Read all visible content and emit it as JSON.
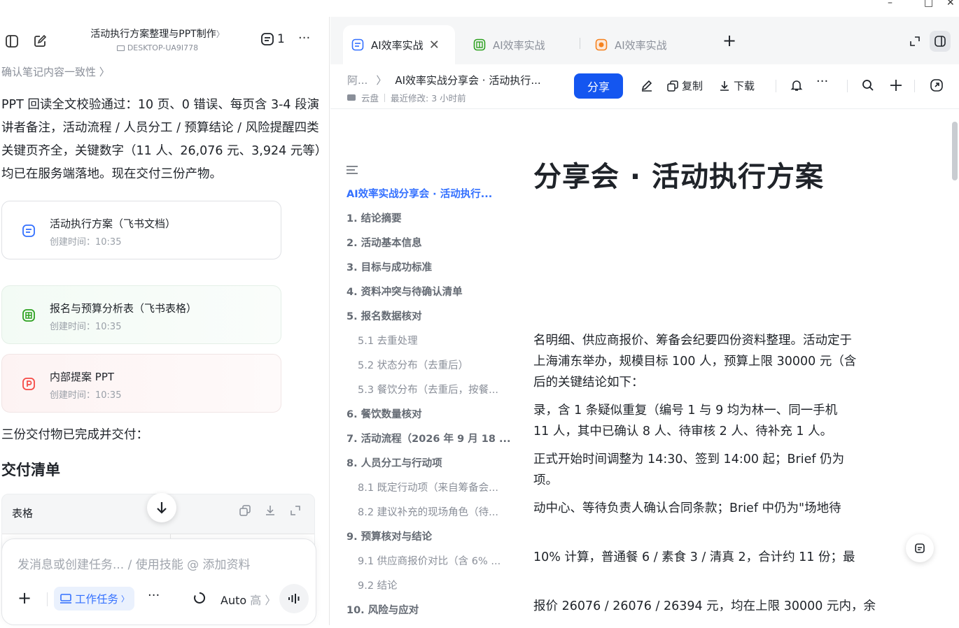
{
  "window": {
    "minimize": "–",
    "maximize": "□",
    "close": "✕"
  },
  "left": {
    "title": "活动执行方案整理与PPT制作",
    "title_chevron": "〉",
    "device": "DESKTOP-UA9I778",
    "message_count": "1",
    "more": "···",
    "confirm_link": "确认笔记内容一致性 〉",
    "summary": "PPT 回读全文校验通过：10 页、0 错误、每页含 3-4 段演讲者备注，活动流程 / 人员分工 / 预算结论 / 风险提醒四类关键页齐全，关键数字（11 人、26,076 元、3,924 元等）均已在服务端落地。现在交付三份产物。",
    "cards": [
      {
        "title": "活动执行方案（飞书文档）",
        "time": "创建时间：10:35",
        "icon": "doc-icon",
        "color": "#3370ff"
      },
      {
        "title": "报名与预算分析表（飞书表格）",
        "time": "创建时间：10:35",
        "icon": "sheet-icon",
        "color": "#2ea121"
      },
      {
        "title": "内部提案 PPT",
        "time": "创建时间：10:35",
        "icon": "ppt-icon",
        "color": "#f54a45"
      }
    ],
    "done_text": "三份交付物已完成并交付：",
    "deliver_title": "交付清单",
    "table_label": "表格",
    "composer": {
      "placeholder": "发消息或创建任务... / 使用技能 @ 添加资料",
      "plus": "+",
      "task_label": "工作任务",
      "task_chevron": "〉",
      "more": "···",
      "model": "Auto",
      "model_level": "高 〉"
    }
  },
  "right": {
    "tabs": [
      {
        "label": "AI效率实战",
        "icon": "doc-icon",
        "color": "#3370ff"
      },
      {
        "label": "AI效率实战",
        "icon": "sheet-icon",
        "color": "#2ea121"
      },
      {
        "label": "AI效率实战",
        "icon": "ppt-icon",
        "color": "#f5821f"
      }
    ],
    "tab_close": "✕",
    "tab_add": "+",
    "breadcrumb": {
      "root": "阿...",
      "sep": "〉",
      "doc": "AI效率实战分享会 · 活动执行..."
    },
    "meta": {
      "location": "云盘",
      "modified": "最近修改: 3 小时前"
    },
    "share": "分享",
    "copy": "复制",
    "download": "下载",
    "more": "···",
    "doc_title": "分享会 · 活动执行方案",
    "outline": [
      {
        "label": "AI效率实战分享会 · 活动执行...",
        "level": "active"
      },
      {
        "label": "1. 结论摘要",
        "level": "h1"
      },
      {
        "label": "2. 活动基本信息",
        "level": "h1"
      },
      {
        "label": "3. 目标与成功标准",
        "level": "h1"
      },
      {
        "label": "4. 资料冲突与待确认清单",
        "level": "h1"
      },
      {
        "label": "5. 报名数据核对",
        "level": "h1"
      },
      {
        "label": "5.1 去重处理",
        "level": "h2"
      },
      {
        "label": "5.2 状态分布（去重后）",
        "level": "h2"
      },
      {
        "label": "5.3 餐饮分布（去重后，按餐...",
        "level": "h2"
      },
      {
        "label": "6. 餐饮数量核对",
        "level": "h1"
      },
      {
        "label": "7. 活动流程（2026 年 9 月 18 ...",
        "level": "h1"
      },
      {
        "label": "8. 人员分工与行动项",
        "level": "h1"
      },
      {
        "label": "8.1 既定行动项（来自筹备会...",
        "level": "h2"
      },
      {
        "label": "8.2 建议补充的现场角色（待...",
        "level": "h2"
      },
      {
        "label": "9. 预算核对与结论",
        "level": "h1"
      },
      {
        "label": "9.1 供应商报价对比（含 6% ...",
        "level": "h2"
      },
      {
        "label": "9.2 结论",
        "level": "h2"
      },
      {
        "label": "10. 风险与应对",
        "level": "h1"
      }
    ],
    "body": [
      [
        "名明细、供应商报价、筹备会纪要四份资料整理。活动定于",
        "上海浦东举办，规模目标 100 人，预算上限 30000 元（含",
        "后的关键结论如下："
      ],
      [
        "录，含 1 条疑似重复（编号 1 与 9 均为林一、同一手机",
        "11 人，其中已确认 8 人、待审核 2 人、待补充 1 人。"
      ],
      [
        "正式开始时间调整为 14:30、签到 14:00 起；Brief 仍为",
        "项。"
      ],
      [
        "动中心、等待负责人确认合同条款；Brief 中仍为\"场地待",
        ""
      ],
      [
        "10% 计算，普通餐 6 / 素食 3 / 清真 2，合计约 11 份；最",
        ""
      ],
      [
        "报价 26076 / 26076 / 26394 元，均在上限 30000 元内，余"
      ]
    ]
  }
}
